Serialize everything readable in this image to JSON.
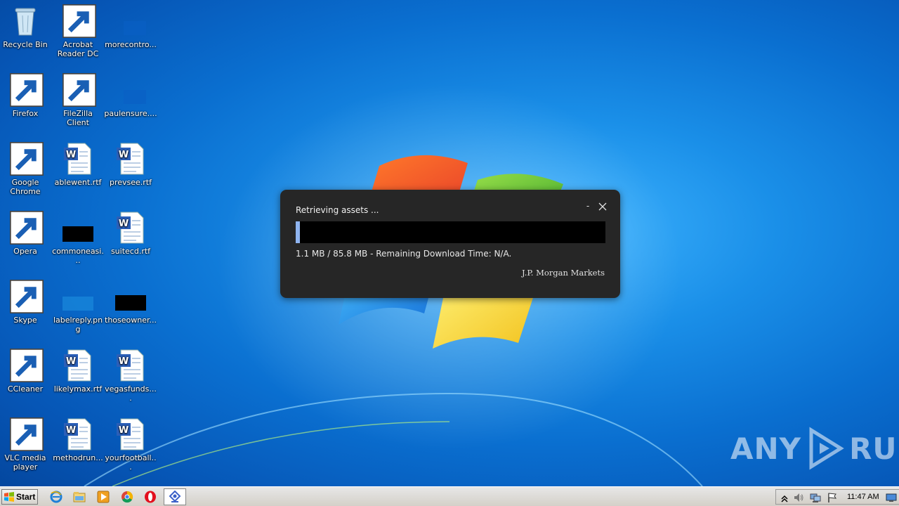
{
  "desktop": {
    "icons": [
      {
        "label": "Recycle Bin"
      },
      {
        "label": "Acrobat\nReader DC"
      },
      {
        "label": "morecontro..."
      },
      {
        "label": "Firefox"
      },
      {
        "label": "FileZilla Client"
      },
      {
        "label": "paulensure...."
      },
      {
        "label": "Google\nChrome"
      },
      {
        "label": "ablewent.rtf"
      },
      {
        "label": "prevsee.rtf"
      },
      {
        "label": "Opera"
      },
      {
        "label": "commoneasi..."
      },
      {
        "label": "suitecd.rtf"
      },
      {
        "label": "Skype"
      },
      {
        "label": "labelreply.png"
      },
      {
        "label": "thoseowner..."
      },
      {
        "label": "CCleaner"
      },
      {
        "label": "likelymax.rtf"
      },
      {
        "label": "vegasfunds...."
      },
      {
        "label": "VLC media\nplayer"
      },
      {
        "label": "methodrun..."
      },
      {
        "label": "yourfootball..."
      }
    ]
  },
  "dialog": {
    "title": "Retrieving assets ...",
    "minimize_label": "-",
    "progress_fraction": 0.013,
    "status": "1.1 MB / 85.8 MB - Remaining Download Time: N/A.",
    "brand": "J.P. Morgan Markets"
  },
  "watermark": {
    "left": "ANY",
    "right": "RUN"
  },
  "taskbar": {
    "start_label": "Start",
    "pinned": [
      "ie-icon",
      "explorer-icon",
      "media-player-icon",
      "chrome-icon",
      "opera-icon",
      "app-icon"
    ],
    "clock": "11:47 AM"
  },
  "colors": {
    "dialog_bg": "#262626",
    "progress_fill": "#8fb4f0",
    "progress_track": "#000000"
  }
}
